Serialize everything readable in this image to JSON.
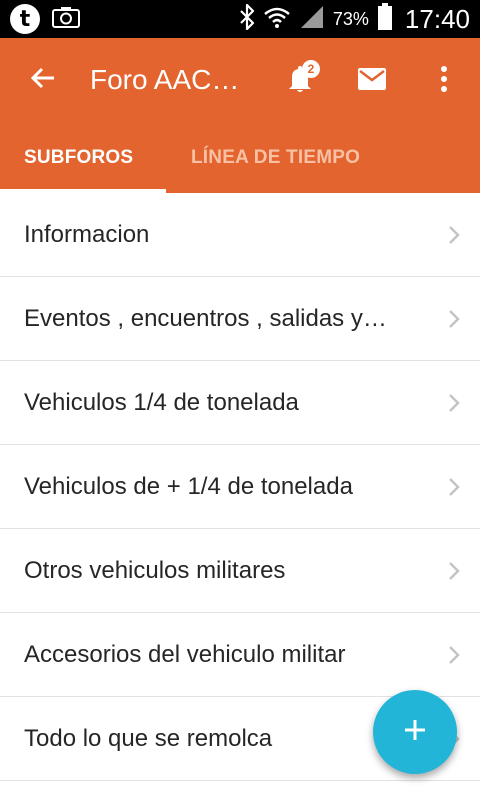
{
  "status_bar": {
    "battery_pct": "73%",
    "time": "17:40",
    "left_icons": [
      "tumblr-icon",
      "camera-icon"
    ],
    "right_icons": [
      "bluetooth-icon",
      "wifi-icon",
      "signal-icon",
      "battery-icon"
    ]
  },
  "toolbar": {
    "title": "Foro AACV…",
    "notification_count": "2",
    "icons": [
      "back-arrow-icon",
      "bell-icon",
      "mail-icon",
      "more-vertical-icon"
    ]
  },
  "tabs": [
    {
      "label": "SUBFOROS",
      "active": true
    },
    {
      "label": "LÍNEA DE TIEMPO",
      "active": false
    }
  ],
  "subforums": [
    "Informacion",
    "Eventos , encuentros , salidas y…",
    "Vehiculos 1/4 de tonelada",
    "Vehiculos de + 1/4 de tonelada",
    "Otros vehiculos militares",
    "Accesorios del vehiculo militar",
    "Todo lo que se remolca"
  ],
  "fab": {
    "icon": "plus-icon"
  },
  "colors": {
    "app_bar": "#e3642f",
    "fab": "#22b5d8",
    "inactive_tab": "#f8c1a4",
    "list_text": "#262626",
    "divider": "#e2e2e2"
  }
}
